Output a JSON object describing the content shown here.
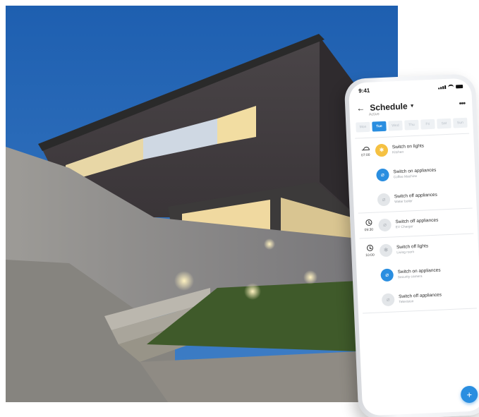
{
  "status": {
    "time": "9:41"
  },
  "header": {
    "title": "Schedule",
    "subtitle": "Active"
  },
  "days": [
    {
      "label": "Mon",
      "active": false
    },
    {
      "label": "Tue",
      "active": true
    },
    {
      "label": "Wed",
      "active": false
    },
    {
      "label": "Thu",
      "active": false
    },
    {
      "label": "Fri",
      "active": false
    },
    {
      "label": "Sat",
      "active": false
    },
    {
      "label": "Sun",
      "active": false
    }
  ],
  "groups": [
    {
      "time": "07:00",
      "icon": "sunrise-icon",
      "items": [
        {
          "title": "Switch on lights",
          "sub": "Kitchen",
          "icon": "bulb-icon",
          "color": "yellow"
        },
        {
          "title": "Switch on appliances",
          "sub": "Coffee Machine",
          "icon": "plug-icon",
          "color": "blue"
        },
        {
          "title": "Switch off appliances",
          "sub": "Water boiler",
          "icon": "plug-icon",
          "color": "grey"
        }
      ]
    },
    {
      "time": "09:30",
      "icon": "clock-icon",
      "items": [
        {
          "title": "Switch off appliances",
          "sub": "EV Charger",
          "icon": "plug-icon",
          "color": "grey"
        }
      ]
    },
    {
      "time": "10:00",
      "icon": "clock-icon",
      "items": [
        {
          "title": "Switch off lights",
          "sub": "Living room",
          "icon": "bulb-icon",
          "color": "grey"
        },
        {
          "title": "Switch on appliances",
          "sub": "Security camera",
          "icon": "plug-icon",
          "color": "blue"
        },
        {
          "title": "Switch off appliances",
          "sub": "Television",
          "icon": "plug-icon",
          "color": "grey"
        }
      ]
    }
  ],
  "fab": {
    "label": "+"
  },
  "colors": {
    "accent": "#2a8ee0",
    "light_on": "#f5c142",
    "inactive": "#e3e6e9"
  }
}
